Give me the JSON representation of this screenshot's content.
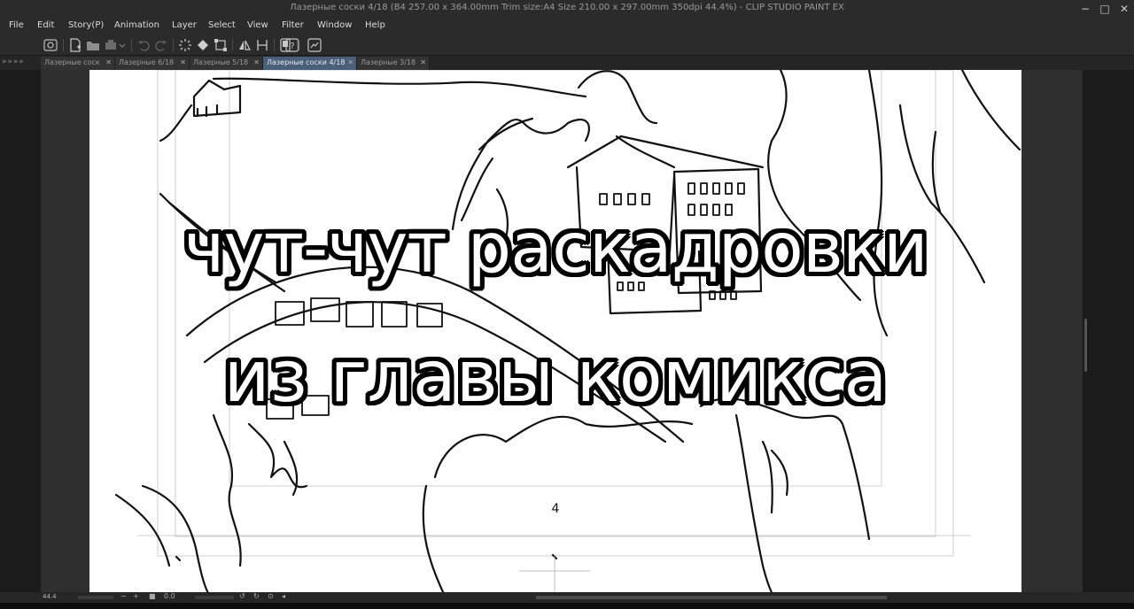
{
  "window": {
    "title": "Лазерные соски 4/18 (B4 257.00 x 364.00mm Trim size:A4 Size 210.00 x 297.00mm 350dpi 44.4%)  - CLIP STUDIO PAINT EX",
    "controls": {
      "minimize": "−",
      "maximize": "□",
      "close": "✕"
    }
  },
  "menu": [
    "File",
    "Edit",
    "Story(P)",
    "Animation",
    "Layer",
    "Select",
    "View",
    "Filter",
    "Window",
    "Help"
  ],
  "toolbar": {
    "icons": [
      "clip-studio-icon",
      "new-file-icon",
      "open-folder-icon",
      "save-icon",
      "undo-icon",
      "redo-icon",
      "loading-icon",
      "fill-icon",
      "transform-icon",
      "flip-icon",
      "ruler-icon",
      "device-icon",
      "help-icon",
      "gallery-icon"
    ]
  },
  "tabs": {
    "overflow": "» » » »",
    "items": [
      {
        "label": "Лазерные соск",
        "active": false
      },
      {
        "label": "Лазерные  6/18",
        "active": false
      },
      {
        "label": "Лазерные  5/18",
        "active": false
      },
      {
        "label": "Лазерные соски 4/18",
        "active": true
      },
      {
        "label": "Лазерные  3/18",
        "active": false
      }
    ]
  },
  "canvas": {
    "page_number": "4",
    "caption_line1": "чут-чут раскадровки",
    "caption_line2": "из главы комикса"
  },
  "statusbar": {
    "zoom": "44.4",
    "angle": "0.0"
  },
  "colors": {
    "chrome": "#2b2b2b",
    "workspace": "#2f2f2f",
    "active_tab": "#4a5f7a",
    "paper": "#ffffff"
  }
}
